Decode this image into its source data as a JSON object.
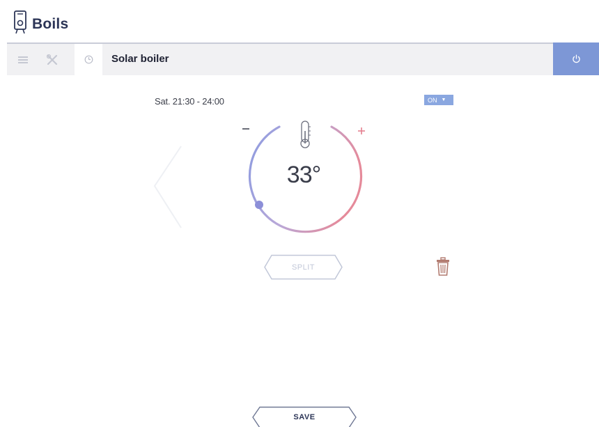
{
  "app": {
    "title": "Boils"
  },
  "toolbar": {
    "tabs": [
      {
        "name": "list",
        "icon": "list-icon"
      },
      {
        "name": "tools",
        "icon": "tools-icon"
      },
      {
        "name": "schedule",
        "icon": "clock-icon",
        "active": true
      }
    ],
    "title": "Solar boiler",
    "power_icon": "power-icon"
  },
  "schedule": {
    "time_range": "Sat. 21:30 - 24:00",
    "mode": "ON"
  },
  "thermostat": {
    "temperature": "33°",
    "minus_label": "–",
    "plus_label": "+",
    "icon": "thermometer-icon"
  },
  "actions": {
    "split_label": "SPLIT",
    "save_label": "SAVE",
    "delete_icon": "trash-icon"
  },
  "colors": {
    "accent": "#7d97d6",
    "dial_cold": "#8c9be0",
    "dial_hot": "#e58a9a",
    "title_text": "#2b3456",
    "delete": "#b27b70"
  }
}
